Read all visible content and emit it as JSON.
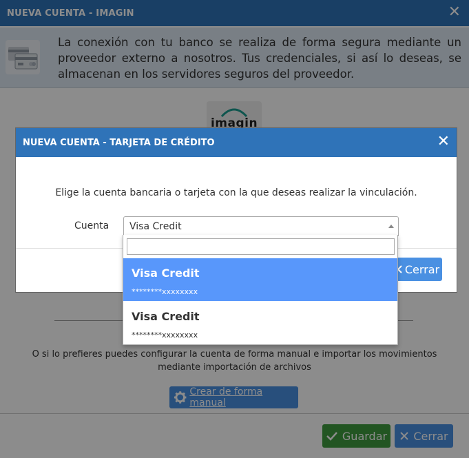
{
  "outer": {
    "title": "NUEVA CUENTA - IMAGIN",
    "close": "✕",
    "info_text": "La conexión con tu banco se realiza de forma segura mediante un proveedor externo a nosotros. Tus credenciales, si así lo deseas, se almacenan en los servidores seguros del proveedor.",
    "logo_text": "imagin",
    "manual_text": "O si lo prefieres puedes configurar la cuenta de forma manual e importar los movimientos mediante importación de archivos",
    "manual_button": "Crear de forma manual",
    "save_button": "Guardar",
    "close_button": "Cerrar"
  },
  "inner": {
    "title": "NUEVA CUENTA - TARJETA DE CRÉDITO",
    "close": "✕",
    "message": "Elige la cuenta bancaria o tarjeta con la que deseas realizar la vinculación.",
    "field_label": "Cuenta",
    "select_value": "Visa Credit",
    "close_button": "Cerrar"
  },
  "dropdown": {
    "search_value": "",
    "options": [
      {
        "title": "Visa Credit",
        "masked": "********xxxxxxxx",
        "selected": true
      },
      {
        "title": "Visa Credit",
        "masked": "********xxxxxxxx",
        "selected": false
      }
    ]
  },
  "colors": {
    "header": "#2f73b8",
    "primary": "#4a90e2",
    "success": "#3e9b3e",
    "highlight": "#5897fb"
  },
  "icons": {
    "info": "credit-card-icon",
    "manual": "gear-icon",
    "save": "check-icon",
    "close": "x-icon"
  }
}
